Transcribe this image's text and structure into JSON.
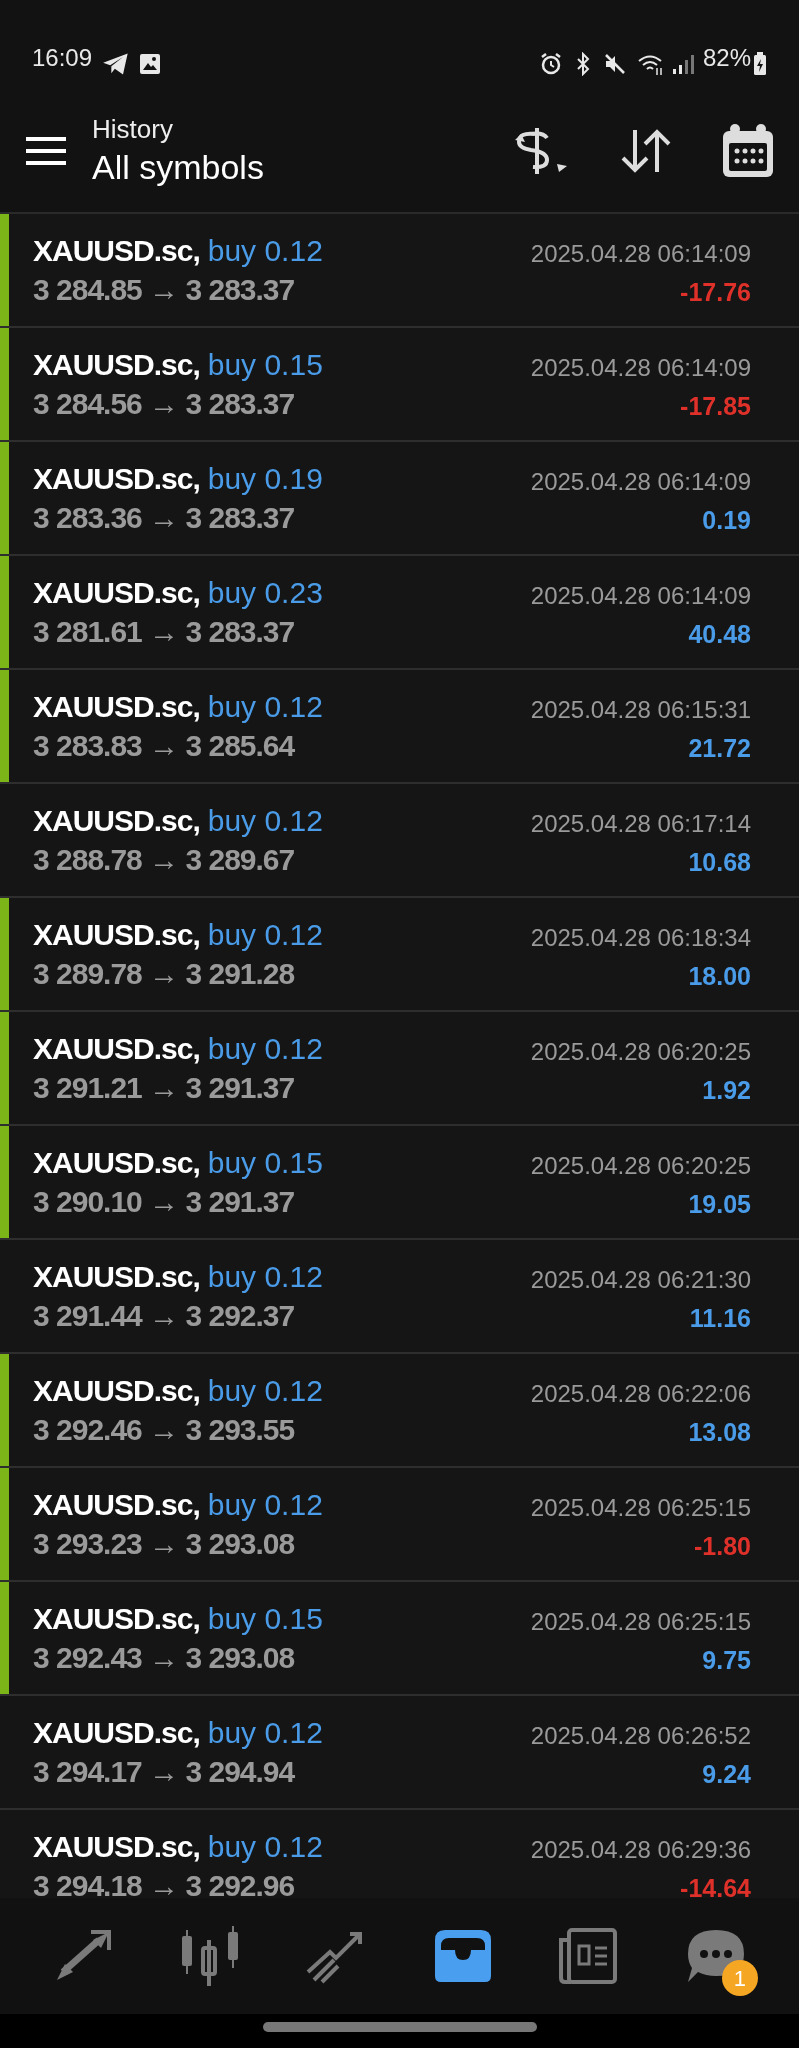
{
  "status_bar": {
    "time": "16:09",
    "battery": "82%"
  },
  "header": {
    "subtitle": "History",
    "title": "All symbols"
  },
  "deals": [
    {
      "symbol": "XAUUSD.sc,",
      "side": "buy 0.12",
      "prices": "3 284.85 → 3 283.37",
      "time": "2025.04.28 06:14:09",
      "profit": "-17.76",
      "loss": true,
      "marked": true
    },
    {
      "symbol": "XAUUSD.sc,",
      "side": "buy 0.15",
      "prices": "3 284.56 → 3 283.37",
      "time": "2025.04.28 06:14:09",
      "profit": "-17.85",
      "loss": true,
      "marked": true
    },
    {
      "symbol": "XAUUSD.sc,",
      "side": "buy 0.19",
      "prices": "3 283.36 → 3 283.37",
      "time": "2025.04.28 06:14:09",
      "profit": "0.19",
      "loss": false,
      "marked": true
    },
    {
      "symbol": "XAUUSD.sc,",
      "side": "buy 0.23",
      "prices": "3 281.61 → 3 283.37",
      "time": "2025.04.28 06:14:09",
      "profit": "40.48",
      "loss": false,
      "marked": true
    },
    {
      "symbol": "XAUUSD.sc,",
      "side": "buy 0.12",
      "prices": "3 283.83 → 3 285.64",
      "time": "2025.04.28 06:15:31",
      "profit": "21.72",
      "loss": false,
      "marked": true
    },
    {
      "symbol": "XAUUSD.sc,",
      "side": "buy 0.12",
      "prices": "3 288.78 → 3 289.67",
      "time": "2025.04.28 06:17:14",
      "profit": "10.68",
      "loss": false,
      "marked": false
    },
    {
      "symbol": "XAUUSD.sc,",
      "side": "buy 0.12",
      "prices": "3 289.78 → 3 291.28",
      "time": "2025.04.28 06:18:34",
      "profit": "18.00",
      "loss": false,
      "marked": true
    },
    {
      "symbol": "XAUUSD.sc,",
      "side": "buy 0.12",
      "prices": "3 291.21 → 3 291.37",
      "time": "2025.04.28 06:20:25",
      "profit": "1.92",
      "loss": false,
      "marked": true
    },
    {
      "symbol": "XAUUSD.sc,",
      "side": "buy 0.15",
      "prices": "3 290.10 → 3 291.37",
      "time": "2025.04.28 06:20:25",
      "profit": "19.05",
      "loss": false,
      "marked": true
    },
    {
      "symbol": "XAUUSD.sc,",
      "side": "buy 0.12",
      "prices": "3 291.44 → 3 292.37",
      "time": "2025.04.28 06:21:30",
      "profit": "11.16",
      "loss": false,
      "marked": false
    },
    {
      "symbol": "XAUUSD.sc,",
      "side": "buy 0.12",
      "prices": "3 292.46 → 3 293.55",
      "time": "2025.04.28 06:22:06",
      "profit": "13.08",
      "loss": false,
      "marked": true
    },
    {
      "symbol": "XAUUSD.sc,",
      "side": "buy 0.12",
      "prices": "3 293.23 → 3 293.08",
      "time": "2025.04.28 06:25:15",
      "profit": "-1.80",
      "loss": true,
      "marked": true
    },
    {
      "symbol": "XAUUSD.sc,",
      "side": "buy 0.15",
      "prices": "3 292.43 → 3 293.08",
      "time": "2025.04.28 06:25:15",
      "profit": "9.75",
      "loss": false,
      "marked": true
    },
    {
      "symbol": "XAUUSD.sc,",
      "side": "buy 0.12",
      "prices": "3 294.17 → 3 294.94",
      "time": "2025.04.28 06:26:52",
      "profit": "9.24",
      "loss": false,
      "marked": false
    },
    {
      "symbol": "XAUUSD.sc,",
      "side": "buy 0.12",
      "prices": "3 294.18 → 3 292.96",
      "time": "2025.04.28 06:29:36",
      "profit": "-14.64",
      "loss": true,
      "marked": false
    }
  ],
  "bottom_nav": [
    {
      "kind": "trade",
      "selected": false
    },
    {
      "kind": "quotes",
      "selected": false
    },
    {
      "kind": "chart",
      "selected": false
    },
    {
      "kind": "history",
      "selected": true
    },
    {
      "kind": "news",
      "selected": false
    },
    {
      "kind": "chat",
      "selected": false,
      "badge": "1"
    }
  ]
}
